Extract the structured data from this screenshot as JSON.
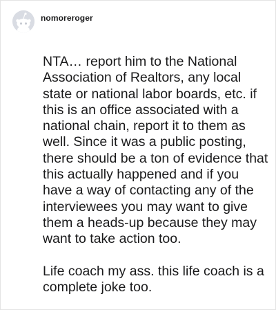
{
  "comment": {
    "username": "nomoreroger",
    "avatar": "default-snoo-avatar",
    "paragraphs": [
      "NTA… report him to the National Association of Realtors, any local state or national labor boards, etc. if this is an office associated with a national chain, report it to them as well. Since it was a public posting, there should be a ton of evidence that this actually happened and if you have a way of contacting any of the interviewees you may want to give them a heads-up because they may want to take action too.",
      "Life coach my ass. this life coach is a complete joke too."
    ]
  }
}
